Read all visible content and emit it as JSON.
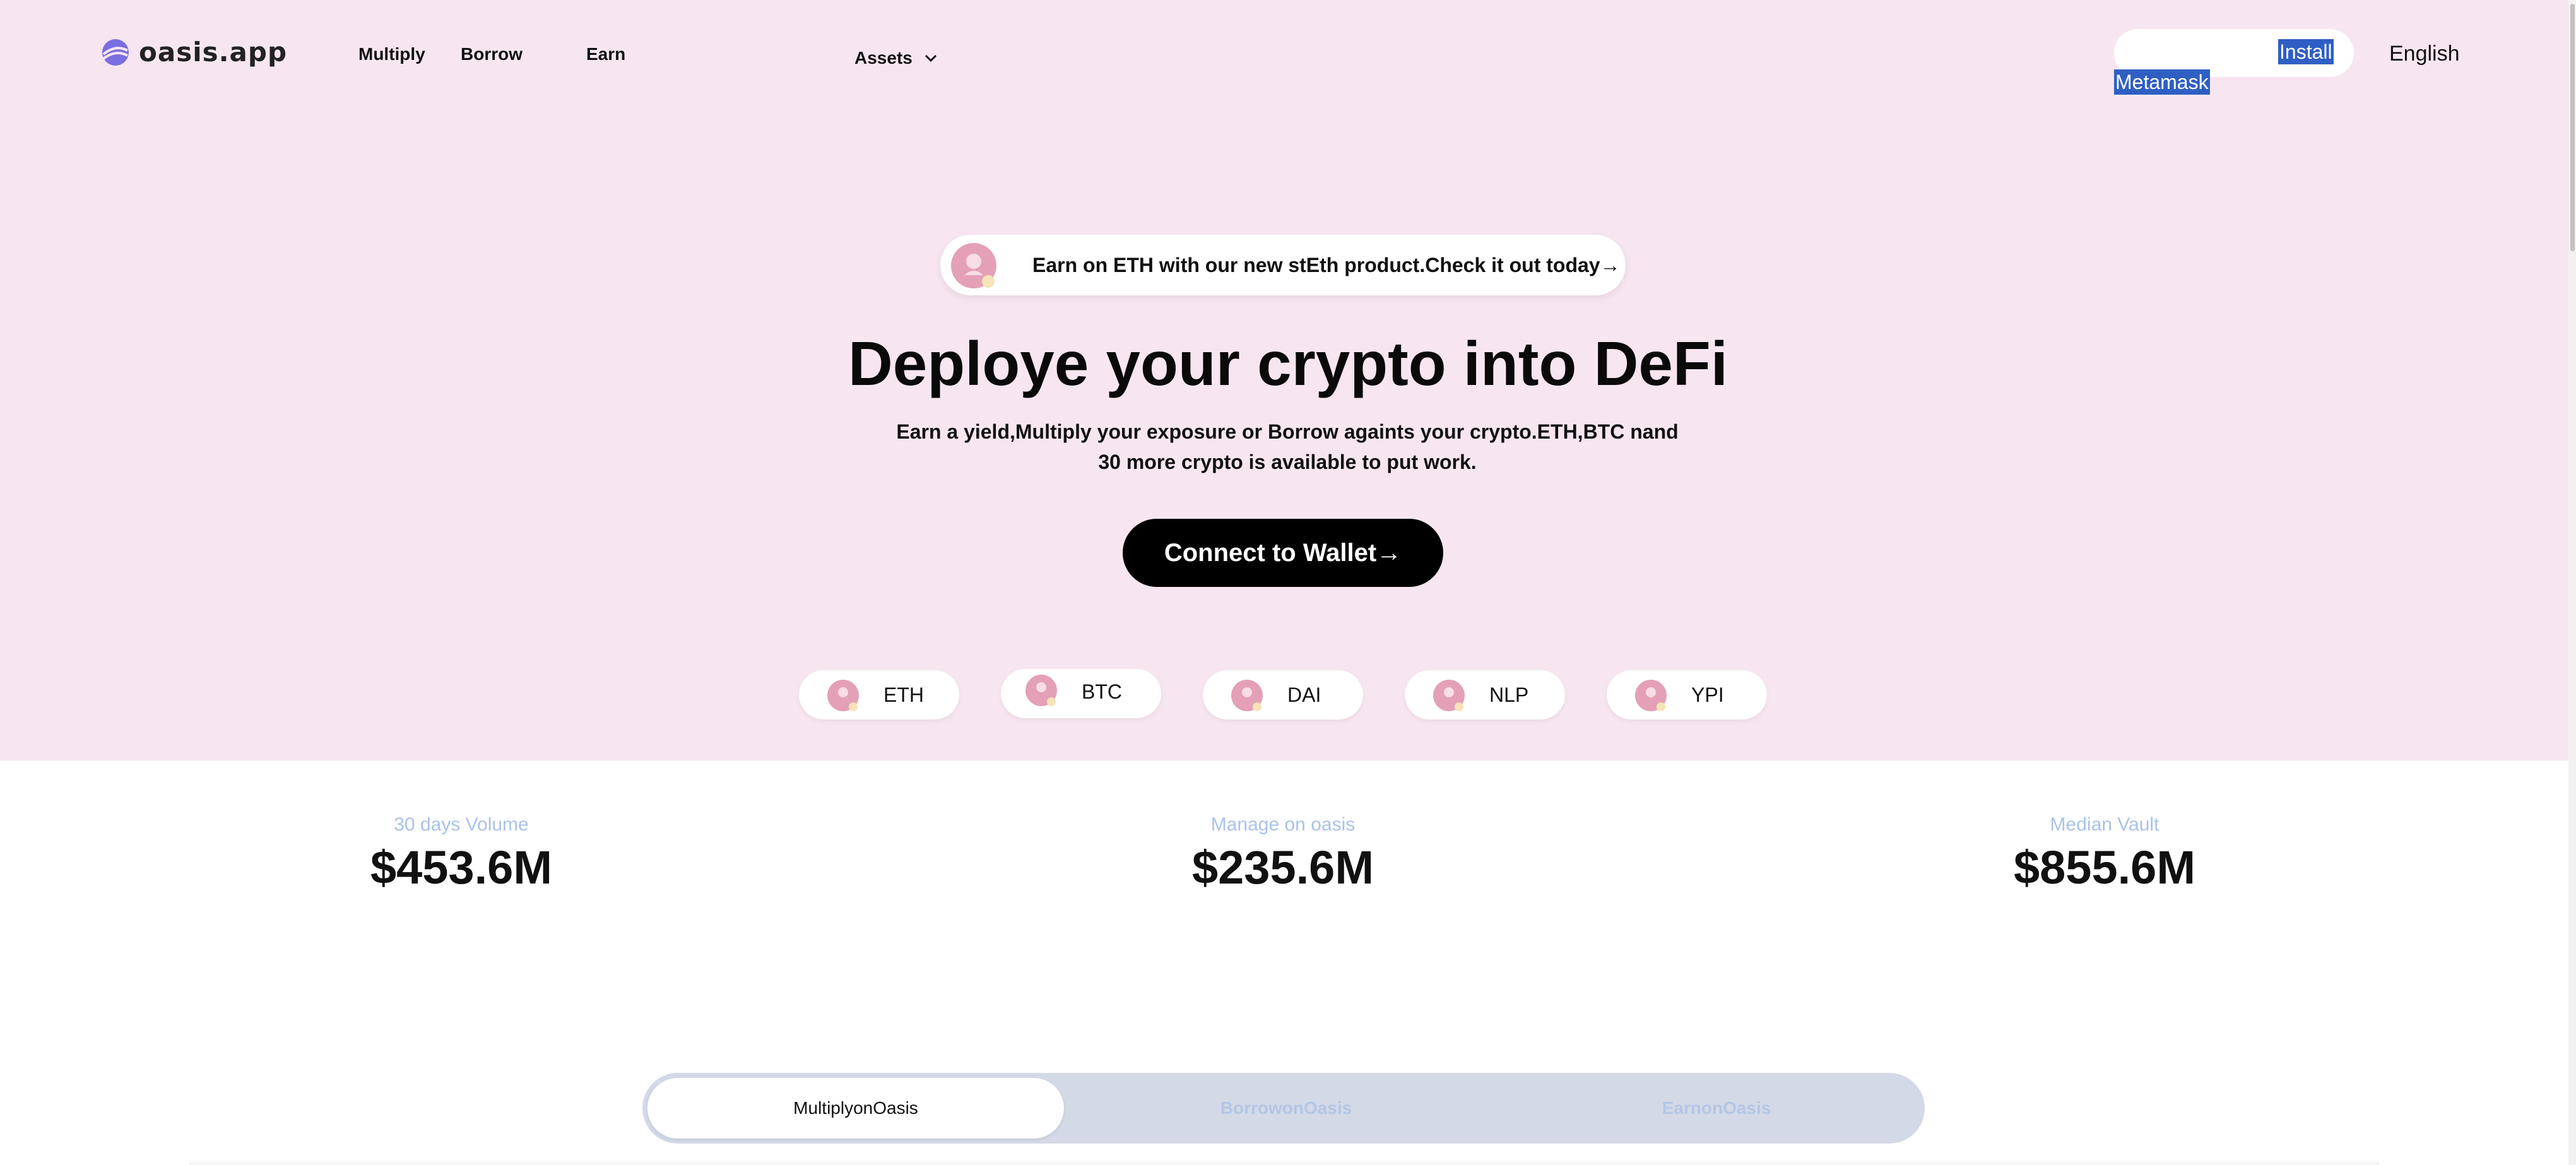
{
  "header": {
    "logo_text": "oasis.app",
    "nav": {
      "multiply": "Multiply",
      "borrow": "Borrow",
      "earn": "Earn",
      "assets": "Assets"
    },
    "install_line1": "Install",
    "install_line2": "Metamask",
    "language": "English"
  },
  "banner": {
    "text": "Earn on ETH with our new stEth product.Check it out today→"
  },
  "hero": {
    "title": "Deploye your crypto into DeFi",
    "subtitle": "Earn a yield,Multiply your exposure or Borrow againts your crypto.ETH,BTC nand 30 more crypto is available to put work.",
    "cta": "Connect to Wallet→"
  },
  "tokens": [
    "ETH",
    "BTC",
    "DAI",
    "NLP",
    "YPI"
  ],
  "stats": [
    {
      "label": "30 days Volume",
      "value": "$453.6M"
    },
    {
      "label": "Manage on oasis",
      "value": "$235.6M"
    },
    {
      "label": "Median Vault",
      "value": "$855.6M"
    }
  ],
  "tabs": [
    "MultiplyonOasis",
    "BorrowonOasis",
    "EarnonOasis"
  ],
  "colors": {
    "hero_bg": "#f7e6f0",
    "stat_label": "#a9c3ea",
    "selection": "#2f5fc4",
    "cta_bg": "#000000",
    "tabbar_bg": "#d3d9e6"
  },
  "icons": {
    "logo": "oasis-logo-icon",
    "assets_toggle": "chevron-down-icon",
    "token": "token-avatar-icon"
  }
}
